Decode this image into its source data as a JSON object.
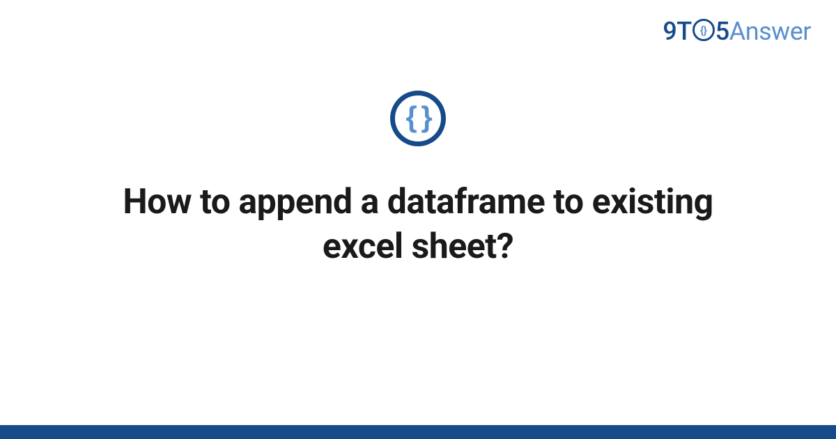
{
  "brand": {
    "part1": "9T",
    "circle_inner": "{}",
    "part2": "5",
    "part3": "Answer"
  },
  "icon": {
    "glyph": "{ }"
  },
  "title": "How to append a dataframe to existing excel sheet?",
  "colors": {
    "primary": "#164a8a",
    "accent": "#5a8fce"
  }
}
